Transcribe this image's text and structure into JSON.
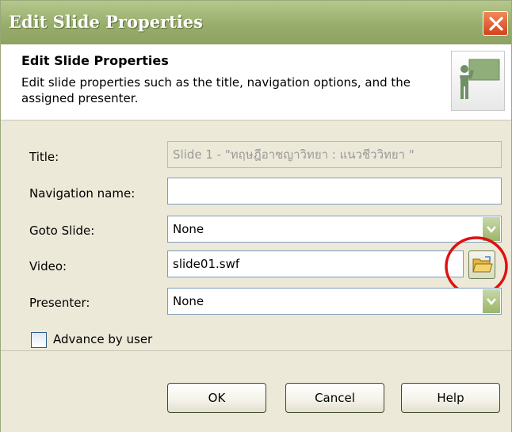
{
  "window": {
    "title": "Edit Slide Properties",
    "close_icon": "close-icon"
  },
  "header": {
    "title": "Edit Slide Properties",
    "description": "Edit slide properties such as the title, navigation options, and the assigned presenter.",
    "icon": "presenter-icon"
  },
  "form": {
    "title_label": "Title:",
    "title_value": "Slide 1 - \"ทฤษฎีอาชญาวิทยา : แนวชีววิทยา \"",
    "navigation_label": "Navigation name:",
    "navigation_value": "",
    "goto_label": "Goto Slide:",
    "goto_value": "None",
    "video_label": "Video:",
    "video_value": "slide01.swf",
    "presenter_label": "Presenter:",
    "presenter_value": "None",
    "advance_label": "Advance by user",
    "advance_checked": false
  },
  "buttons": {
    "ok": "OK",
    "cancel": "Cancel",
    "help": "Help"
  },
  "colors": {
    "titlebar": "#98ad6b",
    "dialog_bg": "#ece9d8",
    "callout_circle": "#e01010",
    "close_button": "#d2431b"
  }
}
